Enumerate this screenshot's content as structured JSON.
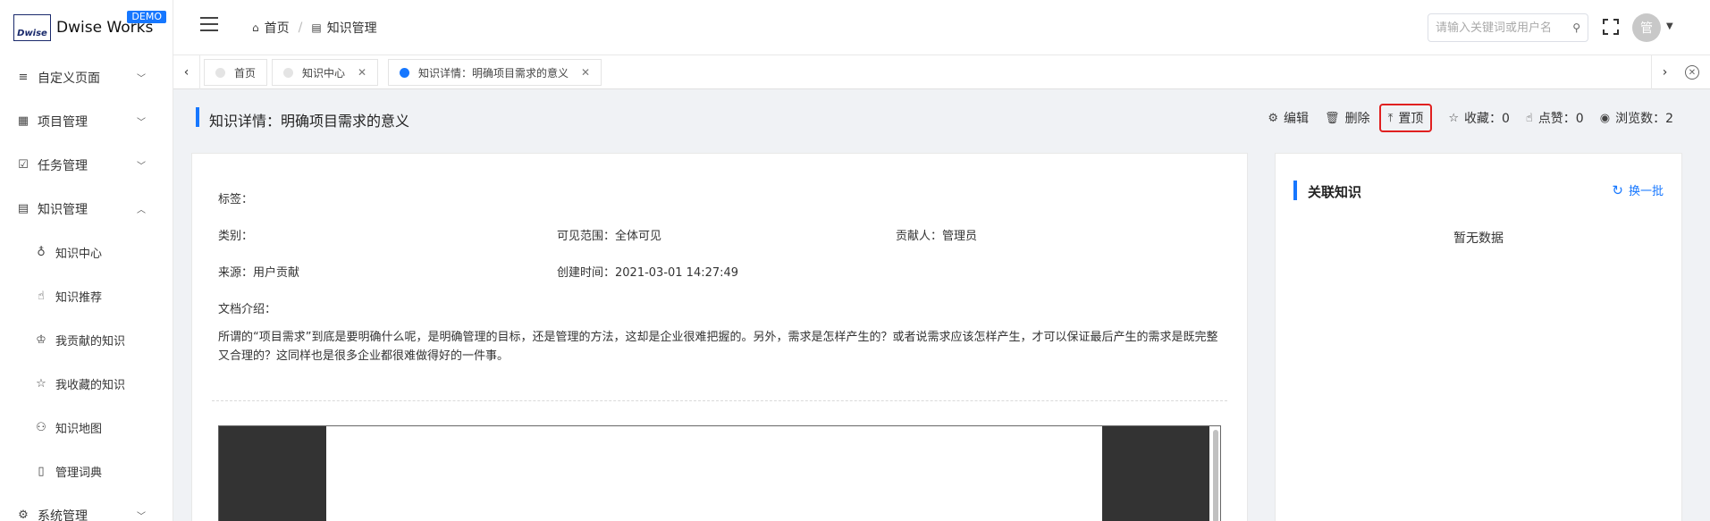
{
  "brand": {
    "name": "Dwise Works",
    "mark": "Dwise",
    "badge": "DEMO"
  },
  "sidebar": {
    "items": [
      {
        "label": "自定义页面",
        "icon": "list-icon"
      },
      {
        "label": "项目管理",
        "icon": "grid-icon"
      },
      {
        "label": "任务管理",
        "icon": "checkbox-icon"
      },
      {
        "label": "知识管理",
        "icon": "book-icon"
      }
    ],
    "sub_items": [
      {
        "label": "知识中心",
        "icon": "bulb-icon"
      },
      {
        "label": "知识推荐",
        "icon": "thumb-icon"
      },
      {
        "label": "我贡献的知识",
        "icon": "trophy-icon"
      },
      {
        "label": "我收藏的知识",
        "icon": "star-icon"
      },
      {
        "label": "知识地图",
        "icon": "sitemap-icon"
      },
      {
        "label": "管理词典",
        "icon": "dictionary-icon"
      }
    ],
    "bottom_item": {
      "label": "系统管理",
      "icon": "gear-icon"
    }
  },
  "header": {
    "breadcrumb": {
      "home": "首页",
      "current": "知识管理"
    },
    "search_placeholder": "请输入关键词或用户名",
    "avatar_text": "管"
  },
  "tabs": [
    {
      "label": "首页"
    },
    {
      "label": "知识中心"
    },
    {
      "label": "知识详情：明确项目需求的意义"
    }
  ],
  "page": {
    "title": "知识详情：明确项目需求的意义",
    "actions": {
      "edit": "编辑",
      "delete": "删除",
      "pin": "置顶",
      "favorites": "收藏：0",
      "likes": "点赞：0",
      "views": "浏览数：2"
    }
  },
  "detail": {
    "tags": "标签：",
    "category": "类别：",
    "visibility": "可见范围：全体可见",
    "contributor": "贡献人：管理员",
    "source": "来源：用户贡献",
    "created": "创建时间：2021-03-01 14:27:49",
    "intro_label": "文档介绍：",
    "intro_text": "所谓的“项目需求”到底是要明确什么呢，是明确管理的目标，还是管理的方法，这却是企业很难把握的。另外，需求是怎样产生的？或者说需求应该怎样产生，才可以保证最后产生的需求是既完整又合理的？这同样也是很多企业都很难做得好的一件事。"
  },
  "related": {
    "title": "关联知识",
    "refresh": "换一批",
    "empty": "暂无数据"
  },
  "colors": {
    "accent": "#1677ff",
    "highlight": "#e02020"
  }
}
